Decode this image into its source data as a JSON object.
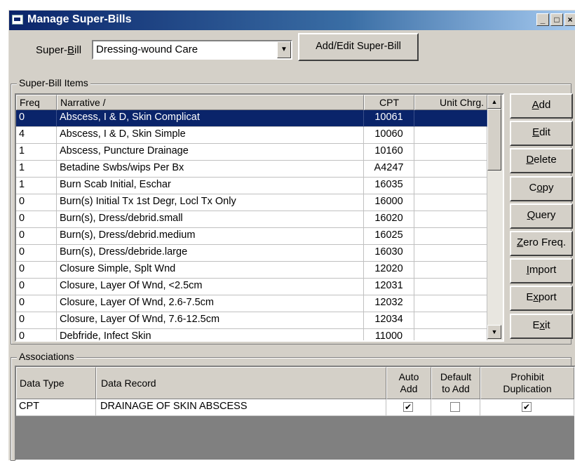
{
  "window": {
    "title": "Manage Super-Bills",
    "minimize": "_",
    "maximize": "□",
    "close": "×"
  },
  "superbill": {
    "label_pre": "Super-",
    "label_u": "B",
    "label_post": "ill",
    "selected": "Dressing-wound Care",
    "add_edit_button": "Add/Edit Super-Bill"
  },
  "items_group": {
    "legend": "Super-Bill Items",
    "columns": [
      "Freq",
      "Narrative /",
      "CPT",
      "Unit Chrg."
    ],
    "rows": [
      {
        "freq": "0",
        "narrative": "Abscess, I & D, Skin Complicat",
        "cpt": "10061",
        "unit": ""
      },
      {
        "freq": "4",
        "narrative": "Abscess, I & D, Skin Simple",
        "cpt": "10060",
        "unit": ""
      },
      {
        "freq": "1",
        "narrative": "Abscess, Puncture Drainage",
        "cpt": "10160",
        "unit": ""
      },
      {
        "freq": "1",
        "narrative": "Betadine Swbs/wips Per Bx",
        "cpt": "A4247",
        "unit": ""
      },
      {
        "freq": "1",
        "narrative": "Burn Scab Initial, Eschar",
        "cpt": "16035",
        "unit": ""
      },
      {
        "freq": "0",
        "narrative": "Burn(s) Initial Tx 1st Degr, Locl Tx Only",
        "cpt": "16000",
        "unit": ""
      },
      {
        "freq": "0",
        "narrative": "Burn(s), Dress/debrid.small",
        "cpt": "16020",
        "unit": ""
      },
      {
        "freq": "0",
        "narrative": "Burn(s), Dress/debrid.medium",
        "cpt": "16025",
        "unit": ""
      },
      {
        "freq": "0",
        "narrative": "Burn(s), Dress/debride.large",
        "cpt": "16030",
        "unit": ""
      },
      {
        "freq": "0",
        "narrative": "Closure Simple, Splt Wnd",
        "cpt": "12020",
        "unit": ""
      },
      {
        "freq": "0",
        "narrative": "Closure, Layer Of Wnd, <2.5cm",
        "cpt": "12031",
        "unit": ""
      },
      {
        "freq": "0",
        "narrative": "Closure, Layer Of Wnd, 2.6-7.5cm",
        "cpt": "12032",
        "unit": ""
      },
      {
        "freq": "0",
        "narrative": "Closure, Layer Of Wnd, 7.6-12.5cm",
        "cpt": "12034",
        "unit": ""
      },
      {
        "freq": "0",
        "narrative": "Debfride, Infect Skin",
        "cpt": "11000",
        "unit": ""
      }
    ],
    "selected_row": 0
  },
  "side_buttons": [
    {
      "pre": "",
      "u": "A",
      "post": "dd",
      "name": "add-button"
    },
    {
      "pre": "",
      "u": "E",
      "post": "dit",
      "name": "edit-button"
    },
    {
      "pre": "",
      "u": "D",
      "post": "elete",
      "name": "delete-button"
    },
    {
      "pre": "C",
      "u": "o",
      "post": "py",
      "name": "copy-button"
    },
    {
      "pre": "",
      "u": "Q",
      "post": "uery",
      "name": "query-button"
    },
    {
      "pre": "",
      "u": "Z",
      "post": "ero Freq.",
      "name": "zero-freq-button"
    },
    {
      "pre": "",
      "u": "I",
      "post": "mport",
      "name": "import-button"
    },
    {
      "pre": "E",
      "u": "x",
      "post": "port",
      "name": "export-button"
    },
    {
      "pre": "E",
      "u": "x",
      "post": "it",
      "name": "exit-button"
    }
  ],
  "associations": {
    "legend": "Associations",
    "columns": {
      "data_type": "Data Type",
      "data_record": "Data Record",
      "auto_add": [
        "Auto",
        "Add"
      ],
      "default_to_add": [
        "Default",
        "to Add"
      ],
      "prohibit_duplication": [
        "Prohibit",
        "Duplication"
      ]
    },
    "rows": [
      {
        "data_type": "CPT",
        "data_record": "DRAINAGE OF SKIN ABSCESS",
        "auto_add": true,
        "default_to_add": false,
        "prohibit_duplication": true
      }
    ]
  },
  "icons": {
    "check": "✔",
    "scroll_up": "▲",
    "scroll_down": "▼",
    "combo_arrow": "▼"
  }
}
